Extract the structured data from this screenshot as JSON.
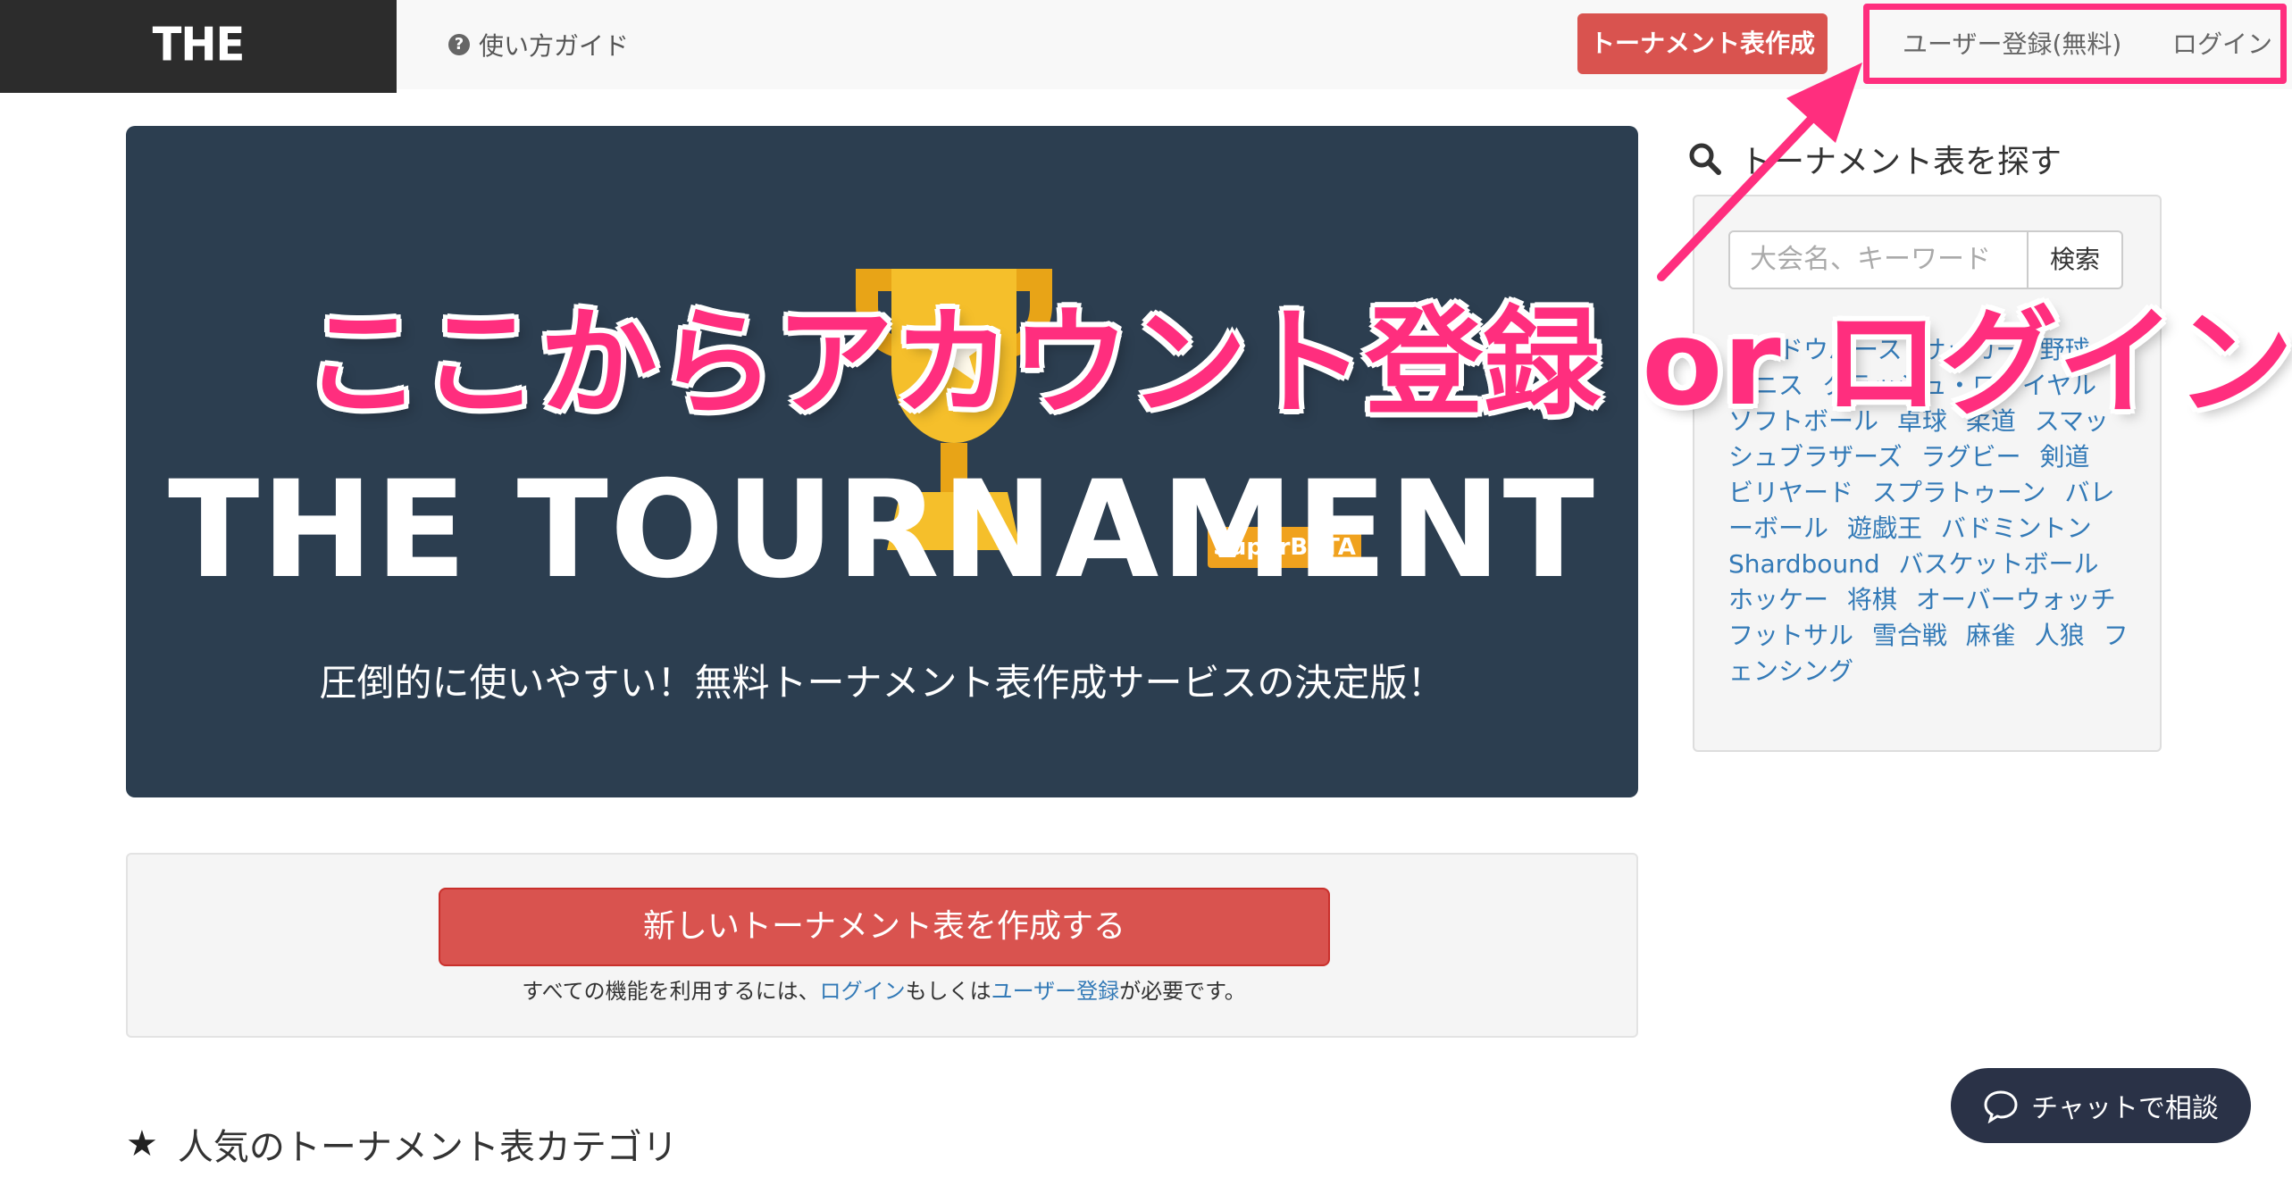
{
  "nav": {
    "brand": "THE TOURNAMENT",
    "guide_label": "使い方ガイド",
    "create_button": "トーナメント表作成",
    "register_link": "ユーザー登録(無料)",
    "login_link": "ログイン"
  },
  "hero": {
    "badge": "SuperBETA",
    "title": "THE TOURNAMENT",
    "subtitle": "圧倒的に使いやすい！無料トーナメント表作成サービスの決定版！"
  },
  "create_panel": {
    "button": "新しいトーナメント表を作成する",
    "note_prefix": "すべての機能を利用するには、",
    "note_login": "ログイン",
    "note_mid": "もしくは",
    "note_register": "ユーザー登録",
    "note_suffix": "が必要です。"
  },
  "popular": {
    "heading": "人気のトーナメント表カテゴリ"
  },
  "sidebar": {
    "heading": "トーナメント表を探す",
    "search_placeholder": "大会名、キーワード",
    "search_button": "検索",
    "tags": [
      "シャドウバース",
      "サッカー",
      "野球",
      "テニス",
      "クラッシュ・ロワイヤル",
      "ソフトボール",
      "卓球",
      "柔道",
      "スマッシュブラザーズ",
      "ラグビー",
      "剣道",
      "ビリヤード",
      "スプラトゥーン",
      "バレーボール",
      "遊戯王",
      "バドミントン",
      "Shardbound",
      "バスケットボール",
      "ホッケー",
      "将棋",
      "オーバーウォッチ",
      "フットサル",
      "雪合戦",
      "麻雀",
      "人狼",
      "フェンシング"
    ]
  },
  "chat": {
    "label": "チャットで相談"
  },
  "annotation": {
    "text": "ここからアカウント登録 or ログイン",
    "color": "#ff2e7e"
  }
}
